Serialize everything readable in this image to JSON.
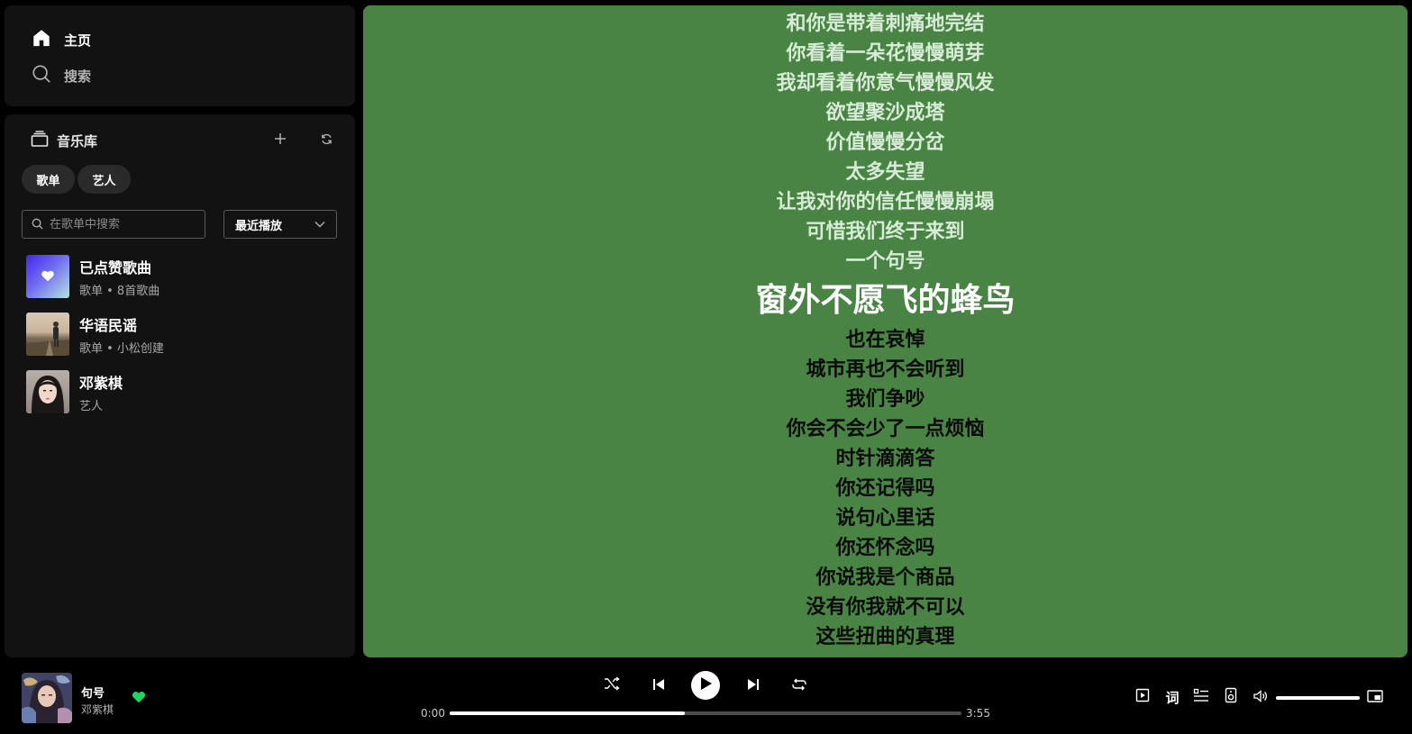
{
  "nav": {
    "home_label": "主页",
    "search_label": "搜索"
  },
  "library": {
    "title": "音乐库",
    "chips": [
      "歌单",
      "艺人"
    ],
    "search_placeholder": "在歌单中搜索",
    "sort_label": "最近播放",
    "items": [
      {
        "title": "已点赞歌曲",
        "subtitle": "歌单 • 8首歌曲"
      },
      {
        "title": "华语民谣",
        "subtitle": "歌单 • 小松创建"
      },
      {
        "title": "邓紫棋",
        "subtitle": "艺人"
      }
    ]
  },
  "lyrics": {
    "background": "#4a8445",
    "past": [
      "和你是带着刺痛地完结",
      "你看着一朵花慢慢萌芽",
      "我却看着你意气慢慢风发",
      "欲望聚沙成塔",
      "价值慢慢分岔",
      "太多失望",
      "让我对你的信任慢慢崩塌",
      "可惜我们终于来到",
      "一个句号"
    ],
    "current": "窗外不愿飞的蜂鸟",
    "upcoming": [
      "也在哀悼",
      "城市再也不会听到",
      "我们争吵",
      "你会不会少了一点烦恼",
      "时针滴滴答",
      "你还记得吗",
      "说句心里话",
      "你还怀念吗",
      "你说我是个商品",
      "没有你我就不可以",
      "这些扭曲的真理"
    ]
  },
  "now_playing": {
    "title": "句号",
    "artist": "邓紫棋",
    "liked": true,
    "like_color": "#1ed760",
    "time_current": "0:00",
    "time_total": "3:55",
    "progress_fraction": 0.46,
    "volume_fraction": 1.0
  },
  "right_controls": {
    "lyrics_label": "词"
  }
}
